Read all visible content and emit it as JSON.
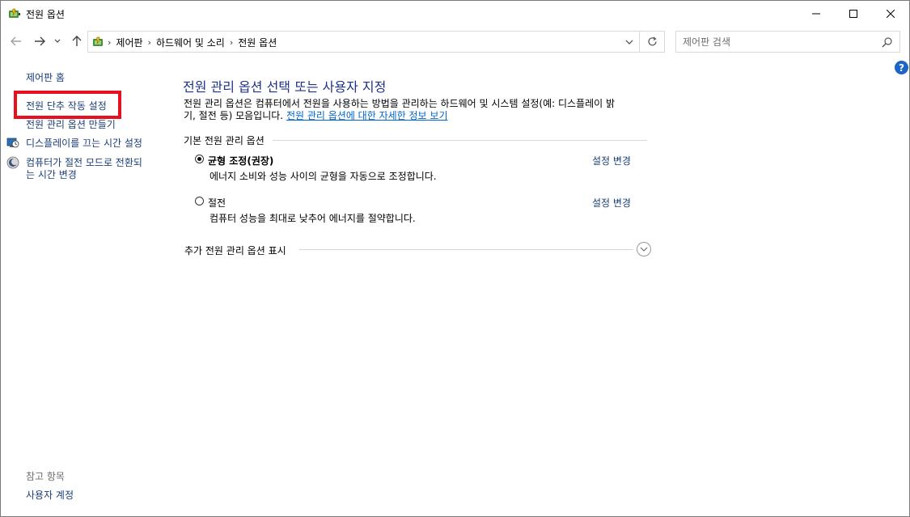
{
  "window": {
    "title": "전원 옵션"
  },
  "navbar": {
    "breadcrumbs": [
      "제어판",
      "하드웨어 및 소리",
      "전원 옵션"
    ],
    "search_placeholder": "제어판 검색"
  },
  "sidebar": {
    "home": "제어판 홈",
    "items": [
      {
        "label": "전원 단추 작동 설정",
        "icon": "none"
      },
      {
        "label": "전원 관리 옵션 만들기",
        "icon": "none"
      },
      {
        "label": "디스플레이를 끄는 시간 설정",
        "icon": "display-clock-icon"
      },
      {
        "label": "컴퓨터가 절전 모드로 전환되는 시간 변경",
        "line1": "컴퓨터가 절전 모드로 전환되",
        "line2": "는 시간 변경",
        "icon": "sleep-moon-icon"
      }
    ],
    "see_also": "참고 항목",
    "user_accounts": "사용자 계정"
  },
  "main": {
    "heading": "전원 관리 옵션 선택 또는 사용자 지정",
    "description_line1": "전원 관리 옵션은 컴퓨터에서 전원을 사용하는 방법을 관리하는 하드웨어 및 시스템 설정(예: 디스플레이 밝",
    "description_line2": "기, 절전 등) 모음입니다.",
    "description_link": "전원 관리 옵션에 대한 자세한 정보 보기",
    "group_label": "기본 전원 관리 옵션",
    "plans": [
      {
        "name": "균형 조정(권장)",
        "description": "에너지 소비와 성능 사이의 균형을 자동으로 조정합니다.",
        "selected": true,
        "change_label": "설정 변경"
      },
      {
        "name": "절전",
        "description": "컴퓨터 성능을 최대로 낮추어 에너지를 절약합니다.",
        "selected": false,
        "change_label": "설정 변경"
      }
    ],
    "more_plans_label": "추가 전원 관리 옵션 표시"
  },
  "colors": {
    "highlight_box": "#e8101e",
    "link": "#1a3e78",
    "heading": "#1e3287",
    "help": "#1c64c8"
  }
}
